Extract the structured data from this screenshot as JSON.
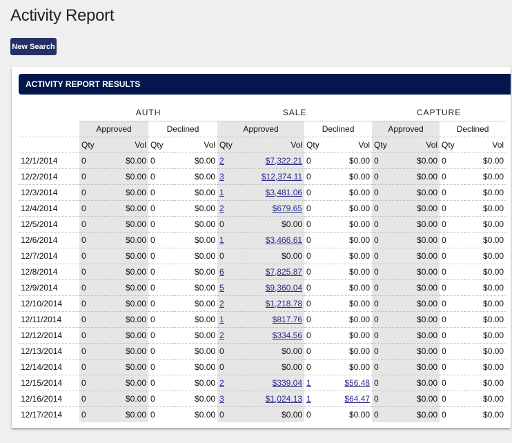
{
  "page_title": "Activity Report",
  "new_search_label": "New Search",
  "results_title": "ACTIVITY REPORT RESULTS",
  "groups": [
    "AUTH",
    "SALE",
    "CAPTURE"
  ],
  "subgroups": [
    "Approved",
    "Declined"
  ],
  "qty_label": "Qty",
  "vol_label": "Vol",
  "rows": [
    {
      "date": "12/1/2014",
      "vals": [
        [
          "0",
          "$0.00"
        ],
        [
          "0",
          "$0.00"
        ],
        [
          "2",
          "$7,322.21"
        ],
        [
          "0",
          "$0.00"
        ],
        [
          "0",
          "$0.00"
        ],
        [
          "0",
          "$0.00"
        ]
      ]
    },
    {
      "date": "12/2/2014",
      "vals": [
        [
          "0",
          "$0.00"
        ],
        [
          "0",
          "$0.00"
        ],
        [
          "3",
          "$12,374.11"
        ],
        [
          "0",
          "$0.00"
        ],
        [
          "0",
          "$0.00"
        ],
        [
          "0",
          "$0.00"
        ]
      ]
    },
    {
      "date": "12/3/2014",
      "vals": [
        [
          "0",
          "$0.00"
        ],
        [
          "0",
          "$0.00"
        ],
        [
          "1",
          "$3,481.06"
        ],
        [
          "0",
          "$0.00"
        ],
        [
          "0",
          "$0.00"
        ],
        [
          "0",
          "$0.00"
        ]
      ]
    },
    {
      "date": "12/4/2014",
      "vals": [
        [
          "0",
          "$0.00"
        ],
        [
          "0",
          "$0.00"
        ],
        [
          "2",
          "$679.65"
        ],
        [
          "0",
          "$0.00"
        ],
        [
          "0",
          "$0.00"
        ],
        [
          "0",
          "$0.00"
        ]
      ]
    },
    {
      "date": "12/5/2014",
      "vals": [
        [
          "0",
          "$0.00"
        ],
        [
          "0",
          "$0.00"
        ],
        [
          "0",
          "$0.00"
        ],
        [
          "0",
          "$0.00"
        ],
        [
          "0",
          "$0.00"
        ],
        [
          "0",
          "$0.00"
        ]
      ]
    },
    {
      "date": "12/6/2014",
      "vals": [
        [
          "0",
          "$0.00"
        ],
        [
          "0",
          "$0.00"
        ],
        [
          "1",
          "$3,466.61"
        ],
        [
          "0",
          "$0.00"
        ],
        [
          "0",
          "$0.00"
        ],
        [
          "0",
          "$0.00"
        ]
      ]
    },
    {
      "date": "12/7/2014",
      "vals": [
        [
          "0",
          "$0.00"
        ],
        [
          "0",
          "$0.00"
        ],
        [
          "0",
          "$0.00"
        ],
        [
          "0",
          "$0.00"
        ],
        [
          "0",
          "$0.00"
        ],
        [
          "0",
          "$0.00"
        ]
      ]
    },
    {
      "date": "12/8/2014",
      "vals": [
        [
          "0",
          "$0.00"
        ],
        [
          "0",
          "$0.00"
        ],
        [
          "6",
          "$7,825.87"
        ],
        [
          "0",
          "$0.00"
        ],
        [
          "0",
          "$0.00"
        ],
        [
          "0",
          "$0.00"
        ]
      ]
    },
    {
      "date": "12/9/2014",
      "vals": [
        [
          "0",
          "$0.00"
        ],
        [
          "0",
          "$0.00"
        ],
        [
          "5",
          "$9,360.04"
        ],
        [
          "0",
          "$0.00"
        ],
        [
          "0",
          "$0.00"
        ],
        [
          "0",
          "$0.00"
        ]
      ]
    },
    {
      "date": "12/10/2014",
      "vals": [
        [
          "0",
          "$0.00"
        ],
        [
          "0",
          "$0.00"
        ],
        [
          "2",
          "$1,218.78"
        ],
        [
          "0",
          "$0.00"
        ],
        [
          "0",
          "$0.00"
        ],
        [
          "0",
          "$0.00"
        ]
      ]
    },
    {
      "date": "12/11/2014",
      "vals": [
        [
          "0",
          "$0.00"
        ],
        [
          "0",
          "$0.00"
        ],
        [
          "1",
          "$817.76"
        ],
        [
          "0",
          "$0.00"
        ],
        [
          "0",
          "$0.00"
        ],
        [
          "0",
          "$0.00"
        ]
      ]
    },
    {
      "date": "12/12/2014",
      "vals": [
        [
          "0",
          "$0.00"
        ],
        [
          "0",
          "$0.00"
        ],
        [
          "2",
          "$334.56"
        ],
        [
          "0",
          "$0.00"
        ],
        [
          "0",
          "$0.00"
        ],
        [
          "0",
          "$0.00"
        ]
      ]
    },
    {
      "date": "12/13/2014",
      "vals": [
        [
          "0",
          "$0.00"
        ],
        [
          "0",
          "$0.00"
        ],
        [
          "0",
          "$0.00"
        ],
        [
          "0",
          "$0.00"
        ],
        [
          "0",
          "$0.00"
        ],
        [
          "0",
          "$0.00"
        ]
      ]
    },
    {
      "date": "12/14/2014",
      "vals": [
        [
          "0",
          "$0.00"
        ],
        [
          "0",
          "$0.00"
        ],
        [
          "0",
          "$0.00"
        ],
        [
          "0",
          "$0.00"
        ],
        [
          "0",
          "$0.00"
        ],
        [
          "0",
          "$0.00"
        ]
      ]
    },
    {
      "date": "12/15/2014",
      "vals": [
        [
          "0",
          "$0.00"
        ],
        [
          "0",
          "$0.00"
        ],
        [
          "2",
          "$339.04"
        ],
        [
          "1",
          "$56.48"
        ],
        [
          "0",
          "$0.00"
        ],
        [
          "0",
          "$0.00"
        ]
      ]
    },
    {
      "date": "12/16/2014",
      "vals": [
        [
          "0",
          "$0.00"
        ],
        [
          "0",
          "$0.00"
        ],
        [
          "3",
          "$1,024.13"
        ],
        [
          "1",
          "$64.47"
        ],
        [
          "0",
          "$0.00"
        ],
        [
          "0",
          "$0.00"
        ]
      ]
    },
    {
      "date": "12/17/2014",
      "vals": [
        [
          "0",
          "$0.00"
        ],
        [
          "0",
          "$0.00"
        ],
        [
          "0",
          "$0.00"
        ],
        [
          "0",
          "$0.00"
        ],
        [
          "0",
          "$0.00"
        ],
        [
          "0",
          "$0.00"
        ]
      ]
    }
  ]
}
